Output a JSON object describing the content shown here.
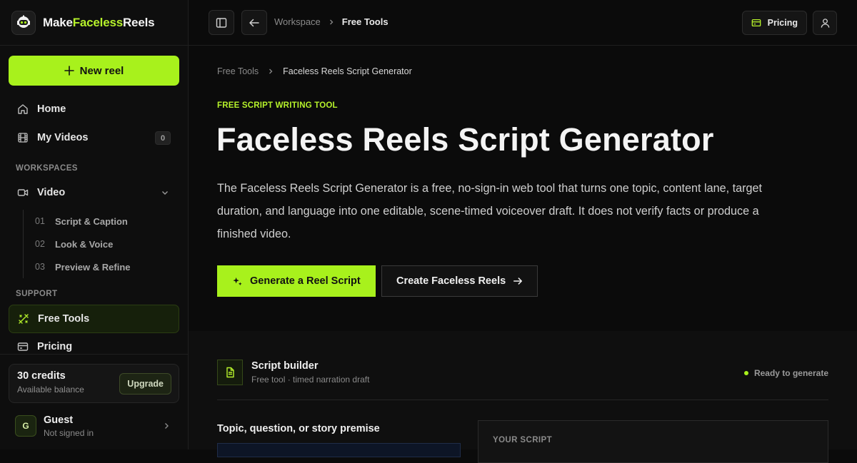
{
  "brand": {
    "part1": "Make",
    "part2": "Faceless",
    "part3": "Reels"
  },
  "sidebar": {
    "new_reel": "New reel",
    "home": "Home",
    "my_videos": "My Videos",
    "my_videos_count": "0",
    "workspaces_label": "WORKSPACES",
    "video": "Video",
    "sub_items": [
      {
        "num": "01",
        "label": "Script & Caption"
      },
      {
        "num": "02",
        "label": "Look & Voice"
      },
      {
        "num": "03",
        "label": "Preview & Refine"
      }
    ],
    "support_label": "SUPPORT",
    "free_tools": "Free Tools",
    "pricing": "Pricing",
    "credits_title": "30 credits",
    "credits_sub": "Available balance",
    "upgrade": "Upgrade",
    "user_initial": "G",
    "user_name": "Guest",
    "user_status": "Not signed in"
  },
  "topbar": {
    "crumb_workspace": "Workspace",
    "crumb_current": "Free Tools",
    "pricing": "Pricing"
  },
  "main": {
    "crumb_parent": "Free Tools",
    "crumb_current": "Faceless Reels Script Generator",
    "eyebrow": "FREE SCRIPT WRITING TOOL",
    "title": "Faceless Reels Script Generator",
    "description": "The Faceless Reels Script Generator is a free, no-sign-in web tool that turns one topic, content lane, target duration, and language into one editable, scene-timed voiceover draft. It does not verify facts or produce a finished video.",
    "primary_cta": "Generate a Reel Script",
    "secondary_cta": "Create Faceless Reels"
  },
  "builder": {
    "title": "Script builder",
    "subtitle": "Free tool · timed narration draft",
    "status": "Ready to generate",
    "field_label": "Topic, question, or story premise",
    "script_label": "YOUR SCRIPT"
  },
  "colors": {
    "accent": "#a8f11c",
    "background": "#0b0b0b"
  }
}
